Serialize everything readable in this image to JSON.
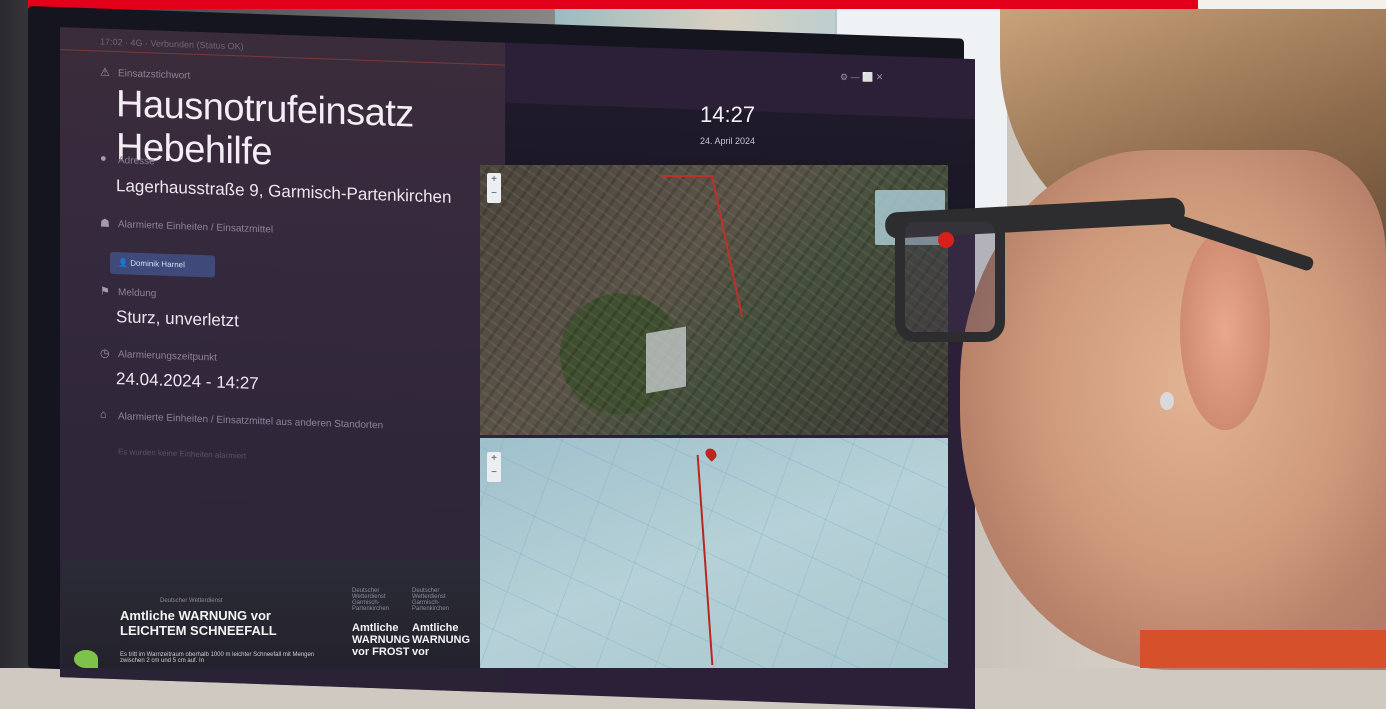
{
  "screen": {
    "device_status": "17:02 · 4G · Verbunden (Status OK)",
    "labels": {
      "keyword": "Einsatzstichwort",
      "address": "Adresse",
      "units": "Alarmierte Einheiten / Einsatzmittel",
      "message": "Meldung",
      "alarm_time": "Alarmierungszeitpunkt",
      "other_units": "Alarmierte Einheiten / Einsatzmittel aus anderen Standorten"
    },
    "keyword_value": "Hausnotrufeinsatz Hebehilfe",
    "address_value": "Lagerhausstraße 9, Garmisch-Partenkirchen",
    "unit_chip": "Dominik Harnel",
    "message_value": "Sturz, unverletzt",
    "alarm_time_value": "24.04.2024 - 14:27",
    "other_units_note": "Es wurden keine Einheiten alarmiert",
    "time": "14:27",
    "date": "24. April 2024",
    "header_controls": "⚙  —  ⬜  ✕"
  },
  "warnings": {
    "main_meta": "Deutscher Wetterdienst",
    "main_title": "Amtliche WARNUNG vor LEICHTEM SCHNEEFALL",
    "main_text": "Es tritt im Warnzeitraum oberhalb 1000 m leichter Schneefall mit Mengen zwischen 2 cm und 5 cm auf. In",
    "side1_meta": "Deutscher Wetterdienst Garmisch-Partenkirchen",
    "side1_title": "Amtliche WARNUNG vor FROST",
    "side2_meta": "Deutscher Wetterdienst Garmisch-Partenkirchen",
    "side2_title": "Amtliche WARNUNG vor"
  },
  "map": {
    "zoom_in": "+",
    "zoom_out": "−"
  },
  "colors": {
    "accent_red": "#e2001a",
    "route_red": "#b8281e",
    "screen_bg": "#2c2038"
  }
}
